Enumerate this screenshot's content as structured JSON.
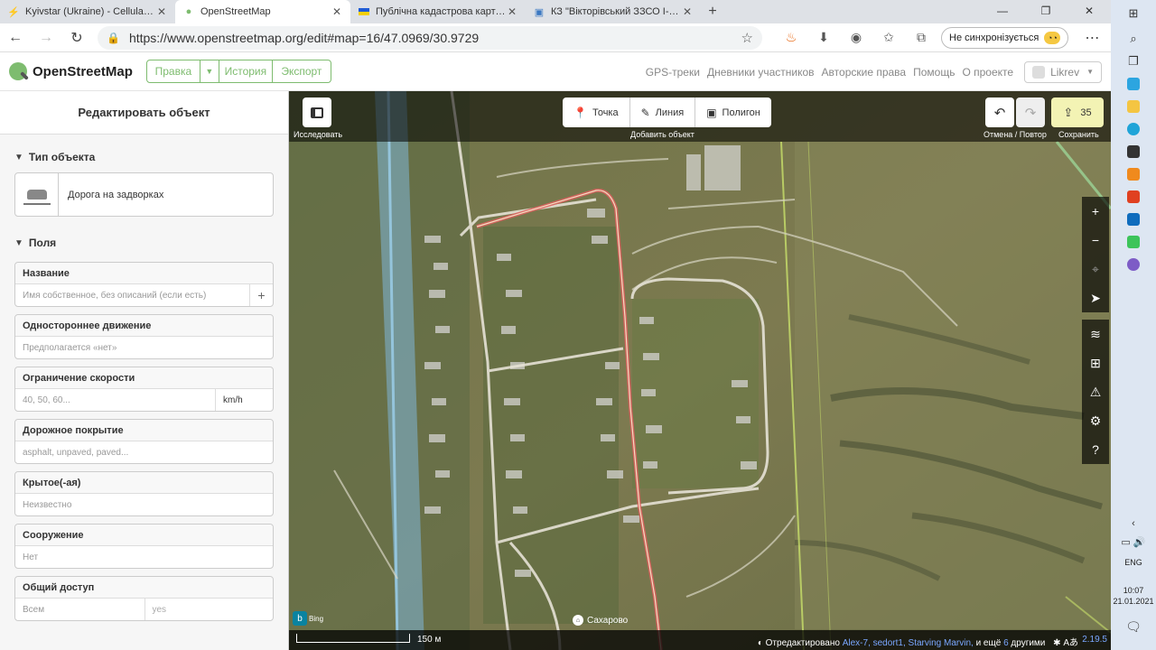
{
  "browser": {
    "tabs": [
      {
        "title": "Kyivstar (Ukraine) - Cellular Cove",
        "icon": "kyivstar-icon",
        "color": "#4caf50"
      },
      {
        "title": "OpenStreetMap",
        "icon": "osm-icon",
        "color": "#7ebc6f",
        "active": true
      },
      {
        "title": "Публічна кадастрова карта Укр",
        "icon": "ukraine-flag-icon",
        "color": "#1e5bd6"
      },
      {
        "title": "КЗ \"Вікторівський ЗЗСО І-ІІ ступ",
        "icon": "page-icon",
        "color": "#3b78c2"
      }
    ],
    "url": "https://www.openstreetmap.org/edit#map=16/47.0969/30.9729",
    "sync_label": "Не синхронізується"
  },
  "osm": {
    "logo_text": "OpenStreetMap",
    "edit_label": "Правка",
    "history_label": "История",
    "export_label": "Экспорт",
    "links": [
      "GPS-треки",
      "Дневники участников",
      "Авторские права",
      "Помощь",
      "О проекте"
    ],
    "username": "Likrev"
  },
  "sidebar": {
    "title": "Редактировать объект",
    "type_section": "Тип объекта",
    "preset_name": "Дорога на задворках",
    "fields_section": "Поля",
    "fields": {
      "name": {
        "label": "Название",
        "placeholder": "Имя собственное, без описаний (если есть)"
      },
      "oneway": {
        "label": "Одностороннее движение",
        "placeholder": "Предполагается «нет»"
      },
      "maxspeed": {
        "label": "Ограничение скорости",
        "placeholder": "40, 50, 60...",
        "unit": "km/h"
      },
      "surface": {
        "label": "Дорожное покрытие",
        "placeholder": "asphalt, unpaved, paved..."
      },
      "covered": {
        "label": "Крытое(-ая)",
        "placeholder": "Неизвестно"
      },
      "structure": {
        "label": "Сооружение",
        "placeholder": "Нет"
      },
      "access": {
        "label": "Общий доступ",
        "placeholder": "Всем",
        "value": "yes"
      }
    }
  },
  "map": {
    "explore_label": "Исследовать",
    "point_label": "Точка",
    "line_label": "Линия",
    "area_label": "Полигон",
    "add_feature_label": "Добавить объект",
    "undo_redo_label": "Отмена / Повтор",
    "save_count": "35",
    "save_label": "Сохранить",
    "scale_label": "150 м",
    "bing_label": "Bing",
    "place_name": "Сахарово",
    "attribution_prefix": "Отредактировано",
    "attribution_users": "Alex-7, sedort1, Starving Marvin,",
    "attribution_mid": "и ещё",
    "attribution_count": "6",
    "attribution_suffix": "другими",
    "version": "2.19.5",
    "selected_way_color": "#e06060"
  },
  "system": {
    "lang": "ENG",
    "time": "10:07",
    "date": "21.01.2021"
  }
}
